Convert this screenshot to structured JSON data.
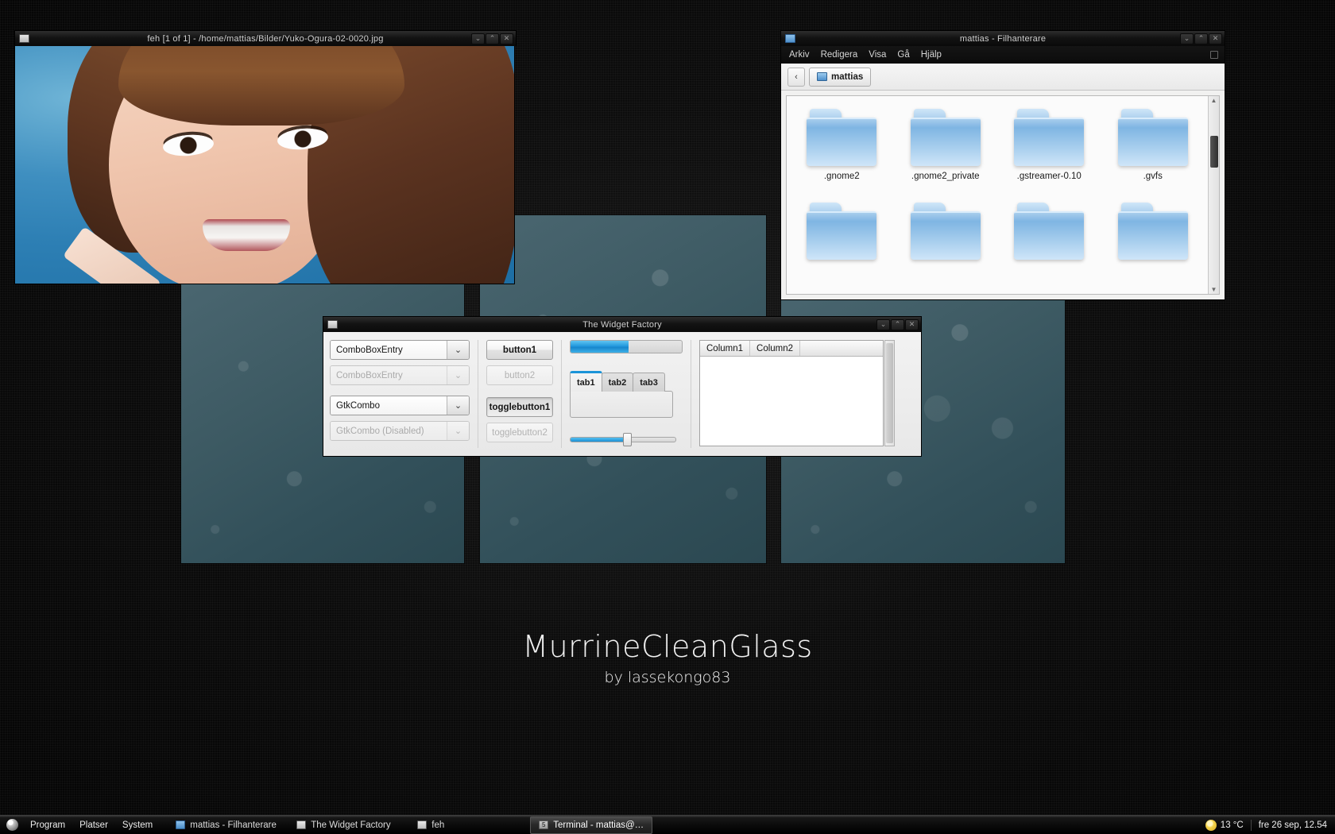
{
  "desktop": {
    "watermark_title": "MurrineCleanGlass",
    "watermark_subtitle": "by lassekongo83",
    "accent_color": "#1f94d6",
    "chrome_color": "#0d0d0d"
  },
  "feh_window": {
    "title": "feh [1 of 1] - /home/mattias/Bilder/Yuko-Ogura-02-0020.jpg",
    "icon": "image-icon",
    "buttons": [
      {
        "name": "minimize-button",
        "glyph": "⌄"
      },
      {
        "name": "maximize-button",
        "glyph": "⌃"
      },
      {
        "name": "close-button",
        "glyph": "✕"
      }
    ]
  },
  "file_manager": {
    "title": "mattias - Filhanterare",
    "icon": "folder-icon",
    "buttons": [
      {
        "name": "minimize-button",
        "glyph": "⌄"
      },
      {
        "name": "maximize-button",
        "glyph": "⌃"
      },
      {
        "name": "close-button",
        "glyph": "✕"
      }
    ],
    "menu": [
      {
        "label": "Arkiv",
        "mnemonic": "A"
      },
      {
        "label": "Redigera",
        "mnemonic": "R"
      },
      {
        "label": "Visa",
        "mnemonic": "V"
      },
      {
        "label": "Gå",
        "mnemonic": "G"
      },
      {
        "label": "Hjälp",
        "mnemonic": "H"
      }
    ],
    "back_button_glyph": "‹",
    "breadcrumb": "mattias",
    "items": [
      {
        "name": ".gnome2"
      },
      {
        "name": ".gnome2_private"
      },
      {
        "name": ".gstreamer-0.10"
      },
      {
        "name": ".gvfs"
      },
      {
        "name": ""
      },
      {
        "name": ""
      },
      {
        "name": ""
      },
      {
        "name": ""
      }
    ],
    "scrollbar": {
      "up_glyph": "▲",
      "down_glyph": "▼"
    }
  },
  "widget_factory": {
    "title": "The Widget Factory",
    "icon": "app-icon",
    "buttons": [
      {
        "name": "minimize-button",
        "glyph": "⌄"
      },
      {
        "name": "maximize-button",
        "glyph": "⌃"
      },
      {
        "name": "close-button",
        "glyph": "✕"
      }
    ],
    "combos": [
      {
        "label": "ComboBoxEntry",
        "disabled": false
      },
      {
        "label": "ComboBoxEntry",
        "disabled": true
      },
      {
        "label": "GtkCombo",
        "disabled": false
      },
      {
        "label": "GtkCombo (Disabled)",
        "disabled": true
      }
    ],
    "combo_arrow_glyph": "⌄",
    "buttons_column": [
      {
        "label": "button1",
        "disabled": false,
        "toggled": false
      },
      {
        "label": "button2",
        "disabled": true,
        "toggled": false
      },
      {
        "label": "togglebutton1",
        "disabled": false,
        "toggled": true
      },
      {
        "label": "togglebutton2",
        "disabled": true,
        "toggled": false
      }
    ],
    "progressbar": {
      "value": 52
    },
    "notebook": {
      "tabs": [
        {
          "label": "tab1",
          "active": true
        },
        {
          "label": "tab2",
          "active": false
        },
        {
          "label": "tab3",
          "active": false
        }
      ]
    },
    "scale": {
      "value": 54
    },
    "treeview": {
      "columns": [
        "Column1",
        "Column2"
      ],
      "rows": []
    }
  },
  "taskbar": {
    "menus": [
      "Program",
      "Platser",
      "System"
    ],
    "menu_icon": "gnome-foot-icon",
    "tasks": [
      {
        "label": "mattias - Filhanterare",
        "icon": "folder-icon",
        "active": false
      },
      {
        "label": "The Widget Factory",
        "icon": "app-icon",
        "active": false
      },
      {
        "label": "feh",
        "icon": "image-icon",
        "active": false
      },
      {
        "label": "Terminal - mattias@…",
        "icon": "terminal-icon",
        "active": true
      }
    ],
    "tray": {
      "weather_icon": "sun-icon",
      "temperature": "13 °C",
      "clock": "fre 26 sep, 12.54"
    }
  }
}
